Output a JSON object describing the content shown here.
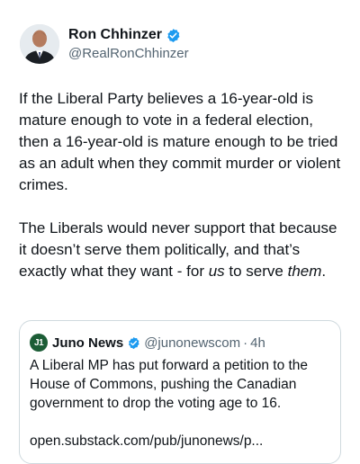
{
  "tweet": {
    "author": {
      "display_name": "Ron Chhinzer",
      "handle": "@RealRonChhinzer",
      "verified_icon": "verified-badge-icon",
      "avatar": "avatar"
    },
    "paragraph1": "If the Liberal Party believes a 16-year-old is mature enough to vote in a federal election, then a 16-year-old is mature enough to be tried as an adult when they commit murder or violent crimes.",
    "paragraph2": {
      "part1": "The Liberals would never support that because it doesn’t serve them politically, and that’s exactly what they want - for ",
      "em1": "us",
      "part2": " to serve ",
      "em2": "them",
      "part3": "."
    }
  },
  "quoted": {
    "logo_text": "J1",
    "display_name": "Juno News",
    "handle": "@junonewscom",
    "separator": "·",
    "time": "4h",
    "text": "A Liberal MP has put forward a petition to the House of Commons, pushing the Canadian government to drop the voting age to 16.",
    "link": "open.substack.com/pub/junonews/p..."
  },
  "colors": {
    "verified_blue": "#1d9bf0",
    "text_primary": "#0f1419",
    "text_secondary": "#536471",
    "border": "#cfd9de",
    "juno_green": "#1c5d36"
  }
}
